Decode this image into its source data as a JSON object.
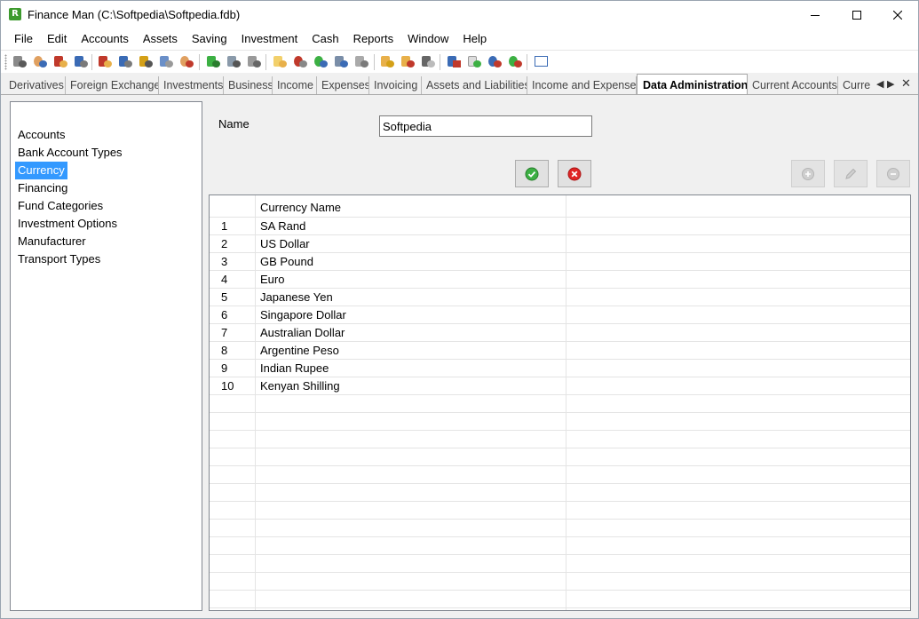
{
  "window": {
    "title": "Finance Man (C:\\Softpedia\\Softpedia.fdb)",
    "app_icon_letter": "R"
  },
  "menu": [
    "File",
    "Edit",
    "Accounts",
    "Assets",
    "Saving",
    "Investment",
    "Cash",
    "Reports",
    "Window",
    "Help"
  ],
  "toolbar": {
    "icons": [
      "building-icon",
      "person-icon",
      "house-icon",
      "car-icon",
      "house-icon",
      "car-icon",
      "truck-icon",
      "computer-icon",
      "person-icon",
      "money-bag-icon",
      "printer-icon",
      "printer-icon",
      "note-icon",
      "globe-icon",
      "globe-icon",
      "document-icon",
      "bank-icon",
      "coins-icon",
      "coins-icon",
      "calculator-icon",
      "bar-chart-icon",
      "report-icon",
      "globe-icon",
      "globe-icon",
      "window-icon"
    ]
  },
  "tabs": [
    "Derivatives",
    "Foreign Exchange",
    "Investments",
    "Business",
    "Income",
    "Expenses",
    "Invoicing",
    "Assets and Liabilities",
    "Income and Expenses",
    "Data Administration",
    "Current Accounts",
    "Curre"
  ],
  "active_tab": "Data Administration",
  "sidebar": {
    "items": [
      "Accounts",
      "Bank Account Types",
      "Currency",
      "Financing",
      "Fund Categories",
      "Investment Options",
      "Manufacturer",
      "Transport Types"
    ],
    "selected": "Currency"
  },
  "form": {
    "name_label": "Name",
    "name_value": "Softpedia"
  },
  "actions": {
    "confirm": "check-icon",
    "cancel": "cancel-icon",
    "add": "plus-icon",
    "edit": "pencil-icon",
    "remove": "minus-icon"
  },
  "grid": {
    "header": "Currency Name",
    "rows": [
      {
        "num": "1",
        "name": "SA Rand"
      },
      {
        "num": "2",
        "name": "US Dollar"
      },
      {
        "num": "3",
        "name": "GB Pound"
      },
      {
        "num": "4",
        "name": "Euro"
      },
      {
        "num": "5",
        "name": "Japanese Yen"
      },
      {
        "num": "6",
        "name": "Singapore Dollar"
      },
      {
        "num": "7",
        "name": "Australian Dollar"
      },
      {
        "num": "8",
        "name": "Argentine Peso"
      },
      {
        "num": "9",
        "name": "Indian Rupee"
      },
      {
        "num": "10",
        "name": "Kenyan Shilling"
      }
    ]
  },
  "colors": {
    "selection": "#3399ff",
    "confirm": "#3cb043",
    "cancel": "#e02424"
  }
}
